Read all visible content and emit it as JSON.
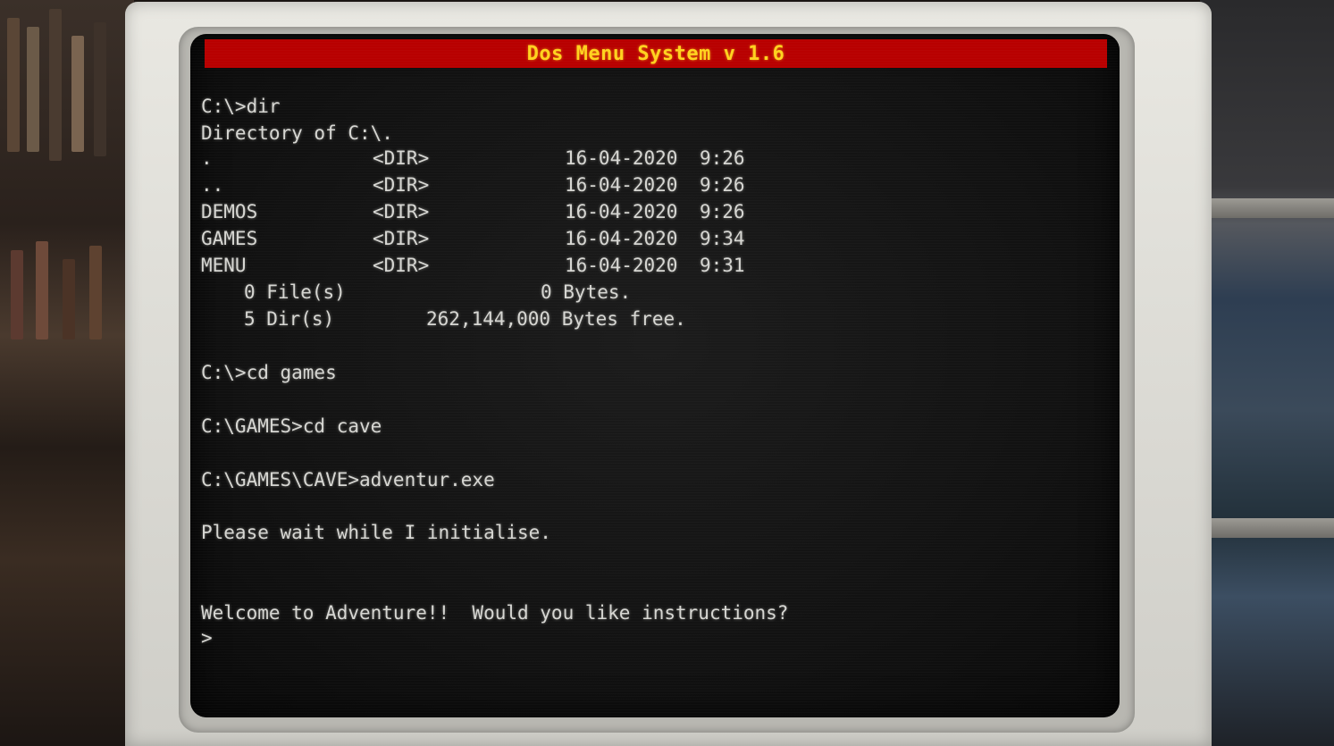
{
  "title_bar": "Dos Menu System v 1.6",
  "terminal": {
    "cmd_dir": "C:\\>dir",
    "dir_header": "Directory of C:\\.",
    "entries": [
      {
        "name": ".",
        "type": "<DIR>",
        "date": "16-04-2020",
        "time": "9:26"
      },
      {
        "name": "..",
        "type": "<DIR>",
        "date": "16-04-2020",
        "time": "9:26"
      },
      {
        "name": "DEMOS",
        "type": "<DIR>",
        "date": "16-04-2020",
        "time": "9:26"
      },
      {
        "name": "GAMES",
        "type": "<DIR>",
        "date": "16-04-2020",
        "time": "9:34"
      },
      {
        "name": "MENU",
        "type": "<DIR>",
        "date": "16-04-2020",
        "time": "9:31"
      }
    ],
    "files_count": "0 File(s)",
    "files_bytes": "0 Bytes.",
    "dirs_count": "5 Dir(s)",
    "dirs_free": "262,144,000 Bytes free.",
    "cmd_cd_games": "C:\\>cd games",
    "cmd_cd_cave": "C:\\GAMES>cd cave",
    "cmd_run": "C:\\GAMES\\CAVE>adventur.exe",
    "wait_msg": "Please wait while I initialise.",
    "welcome_msg": "Welcome to Adventure!!  Would you like instructions?",
    "prompt": ">"
  },
  "colors": {
    "title_bg": "#b80000",
    "title_fg": "#ffd21f",
    "text": "#d6d6d2",
    "screen_bg": "#121212"
  }
}
